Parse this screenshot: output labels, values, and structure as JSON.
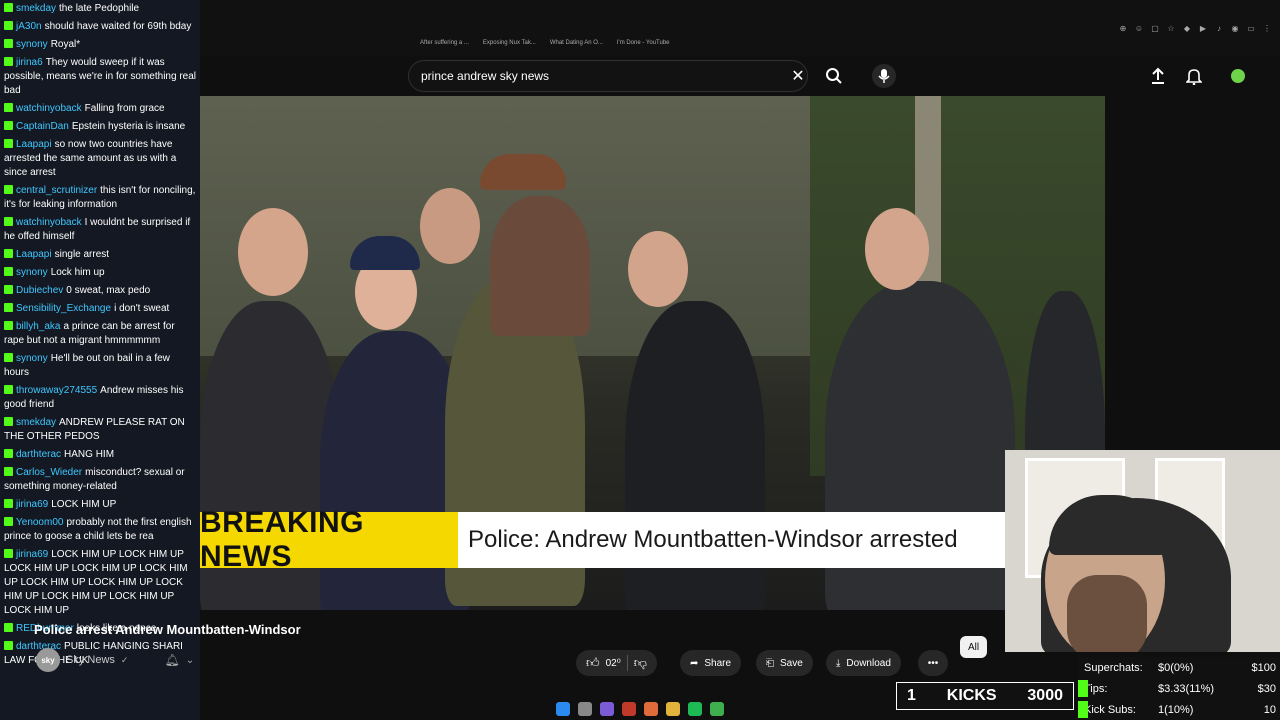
{
  "chat": {
    "messages": [
      {
        "user": "smekday",
        "text": "the late Pedophile"
      },
      {
        "user": "jA30n",
        "text": "should have waited for 69th bday"
      },
      {
        "user": "synony",
        "text": "Royal*"
      },
      {
        "user": "jirina6",
        "text": "They would sweep if it was possible, means we're in for something real bad"
      },
      {
        "user": "watchinyoback",
        "text": "Falling from grace"
      },
      {
        "user": "CaptainDan",
        "text": "Epstein hysteria is insane"
      },
      {
        "user": "Laapapi",
        "text": "so now two countries have arrested the same amount as us with a since arrest"
      },
      {
        "user": "central_scrutinizer",
        "text": "this isn't for nonciling, it's for leaking information"
      },
      {
        "user": "watchinyoback",
        "text": "I wouldnt be surprised if he offed himself"
      },
      {
        "user": "Laapapi",
        "text": "single arrest"
      },
      {
        "user": "synony",
        "text": "Lock him up"
      },
      {
        "user": "Dubiechev",
        "text": "0 sweat, max pedo"
      },
      {
        "user": "Sensibility_Exchange",
        "text": "i don't sweat"
      },
      {
        "user": "billyh_aka",
        "text": "a prince can be arrest for rape but not a migrant hmmmmmm"
      },
      {
        "user": "synony",
        "text": "He'll be out on bail in a few hours"
      },
      {
        "user": "throwaway274555",
        "text": "Andrew misses his good friend"
      },
      {
        "user": "smekday",
        "text": "ANDREW PLEASE RAT ON THE OTHER PEDOS"
      },
      {
        "user": "darthterac",
        "text": "HANG HIM"
      },
      {
        "user": "Carlos_Wieder",
        "text": "misconduct? sexual or something money-related"
      },
      {
        "user": "jirina69",
        "text": "LOCK HIM UP"
      },
      {
        "user": "Yenoom00",
        "text": "probably not the first english prince to goose a child lets be rea"
      },
      {
        "user": "jirina69",
        "text": "LOCK HIM UP LOCK HIM UP LOCK HIM UP LOCK HIM UP LOCK HIM UP LOCK HIM UP LOCK HIM UP LOCK HIM UP LOCK HIM UP LOCK HIM UP LOCK HIM UP"
      },
      {
        "user": "REDbummer",
        "text": "looks like a nonce"
      },
      {
        "user": "darthterac",
        "text": "PUBLIC HANGING SHARI LAW FOR THE UK"
      }
    ]
  },
  "browser": {
    "bookmarks": [
      "After suffering a ...",
      "Exposing Nux Tak...",
      "What Dating An O...",
      "I'm Done - YouTube"
    ]
  },
  "search": {
    "query": "prince andrew sky news"
  },
  "video": {
    "breaking_tag": "BREAKING NEWS",
    "headline": "Police: Andrew Mountbatten-Windsor arrested",
    "title": "Police arrest Andrew Mountbatten-Windsor",
    "channel": "Sky News",
    "channel_avatar": "sky"
  },
  "actions": {
    "like_count": "02⁰",
    "share": "Share",
    "save": "Save",
    "download": "Download",
    "chip_all": "All"
  },
  "stream": {
    "kicks_rank": "1",
    "kicks_label": "KICKS",
    "kicks_goal": "3000",
    "superchats_label": "Superchats:",
    "superchats_value": "$0(0%)",
    "superchats_goal": "$100",
    "tips_label": "Tips:",
    "tips_value": "$3.33(11%)",
    "tips_goal": "$30",
    "kicksubs_label": "Kick Subs:",
    "kicksubs_value": "1(10%)",
    "kicksubs_goal": "10"
  },
  "colors": {
    "breaking_yellow": "#f5d800",
    "kick_green": "#53fc18",
    "chat_username": "#3ec7ff"
  }
}
